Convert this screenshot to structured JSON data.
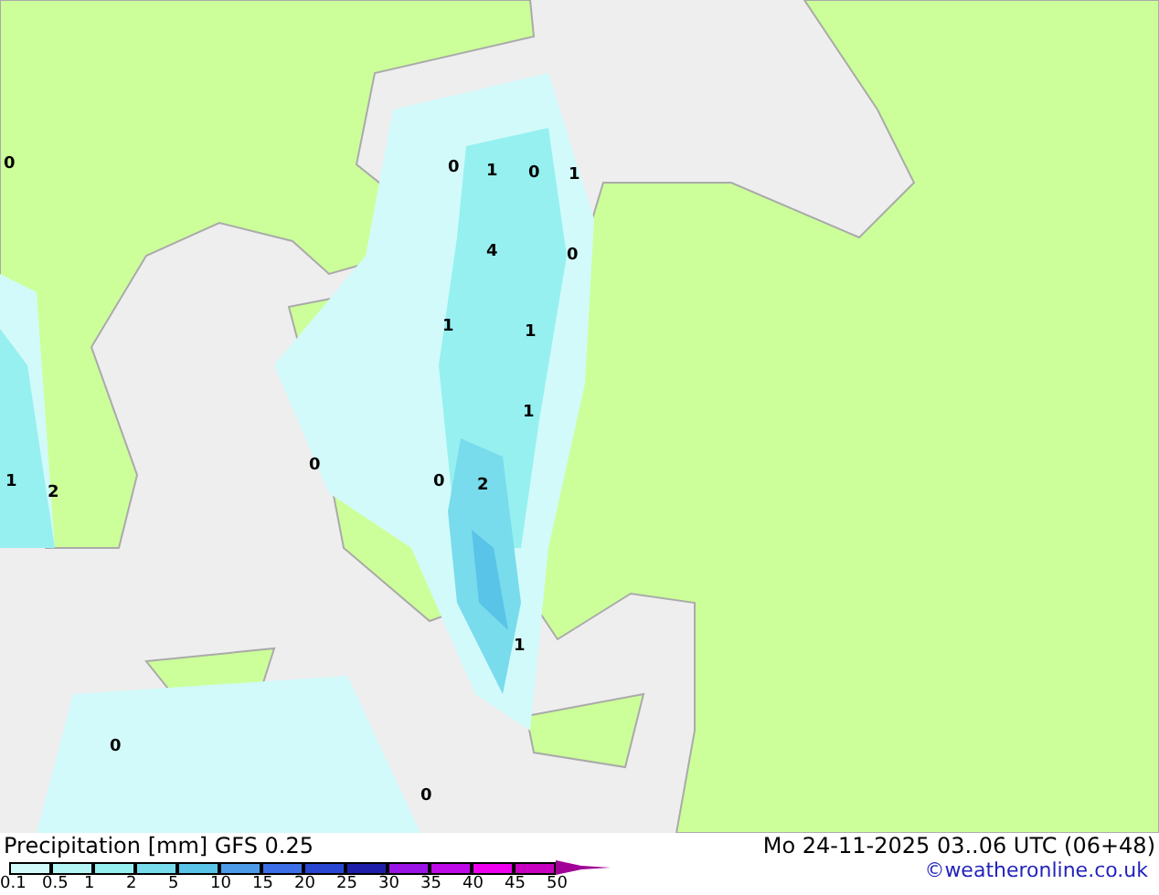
{
  "map": {
    "value_labels": [
      "0",
      "0",
      "1",
      "0",
      "1",
      "4",
      "0",
      "1",
      "1",
      "1",
      "1",
      "2",
      "0",
      "0",
      "2",
      "1",
      "0",
      "0"
    ]
  },
  "legend": {
    "title": "Precipitation [mm] GFS 0.25",
    "valid_time": "Mo 24-11-2025 03..06 UTC (06+48)",
    "credit": "©weatheronline.co.uk",
    "segments": [
      {
        "color": "#d2fafa"
      },
      {
        "color": "#b4f5f5"
      },
      {
        "color": "#96f0f0"
      },
      {
        "color": "#78dcec"
      },
      {
        "color": "#5ac3e8"
      },
      {
        "color": "#4b9be8"
      },
      {
        "color": "#3c6ee8"
      },
      {
        "color": "#2846d2"
      },
      {
        "color": "#1e1eaa"
      },
      {
        "color": "#9a14e6"
      },
      {
        "color": "#be0ae6"
      },
      {
        "color": "#ee00ee"
      },
      {
        "color": "#c800c0"
      }
    ],
    "ticks": [
      "0.1",
      "0.5",
      "1",
      "2",
      "5",
      "10",
      "15",
      "20",
      "25",
      "30",
      "35",
      "40",
      "45",
      "50"
    ]
  }
}
